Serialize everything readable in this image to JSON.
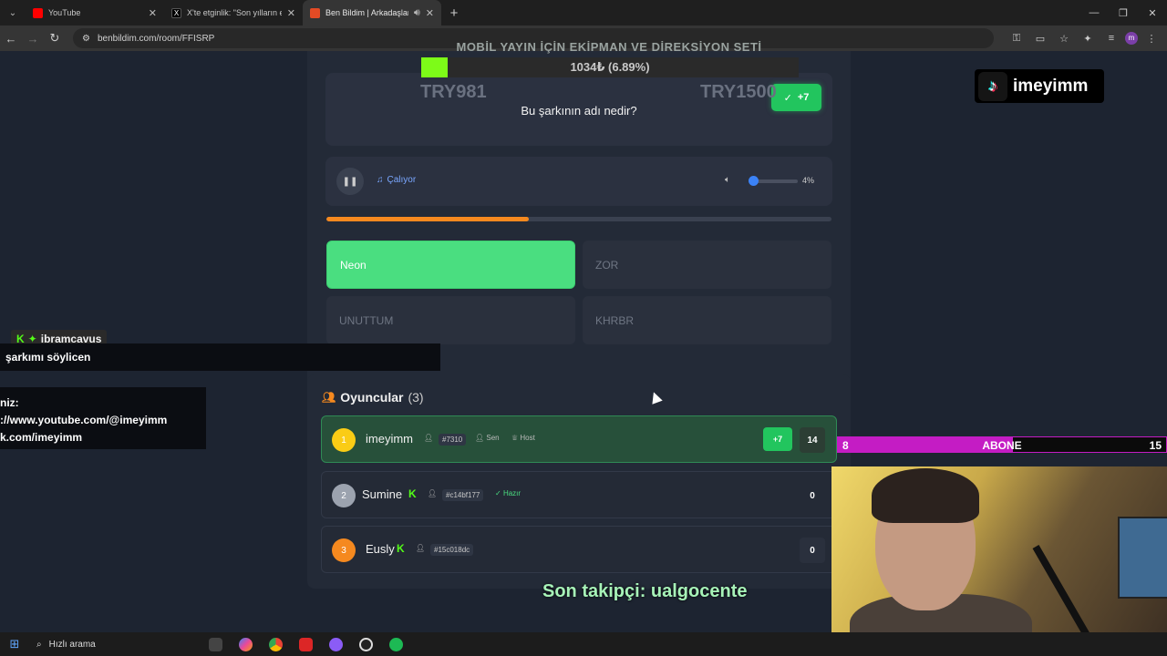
{
  "browser": {
    "tabs": [
      {
        "title": "YouTube",
        "active": false
      },
      {
        "title": "X'te etginlik: \"Son yılların en he",
        "active": false
      },
      {
        "title": "Ben Bildim | Arkadaşlarınla",
        "active": true
      }
    ],
    "url": "benbildim.com/room/FFISRP"
  },
  "donation_goal": {
    "title": "MOBİL YAYIN İÇİN EKİPMAN VE DİREKSİYON SETİ",
    "amount_text": "1034₺ (6.89%)",
    "progress_percent": 6.89,
    "left_label": "TRY981",
    "right_label": "TRY1500"
  },
  "question": {
    "text": "Bu şarkının adı nedir?",
    "badge": "+7"
  },
  "audio": {
    "status": "Çalıyor",
    "volume_text": "4%",
    "volume_percent": 4,
    "time_progress_percent": 40
  },
  "answers": [
    {
      "label": "Neon",
      "selected": true
    },
    {
      "label": "ZOR",
      "selected": false
    },
    {
      "label": "UNUTTUM",
      "selected": false
    },
    {
      "label": "KHRBR",
      "selected": false
    }
  ],
  "players_panel": {
    "title": "Oyuncular",
    "count": "(3)",
    "players": [
      {
        "rank": "1",
        "name": "imeyimm",
        "tag": "#7310",
        "you": "Sen",
        "role": "Host",
        "score": "14",
        "gain": "+7"
      },
      {
        "rank": "2",
        "name": "Sumine",
        "tag": "#c14bf177",
        "status": "Hazır",
        "score": "0"
      },
      {
        "rank": "3",
        "name": "Eusly",
        "tag": "#15c018dc",
        "score": "0"
      }
    ]
  },
  "overlay": {
    "tiktok_name": "imeyimm",
    "chat_user": "ibramcavus",
    "chat_message": "şarkımı söylicen",
    "social_lines": [
      "niz:",
      "://www.youtube.com/@imeyimm",
      "k.com/imeyimm"
    ],
    "sub_goal": {
      "current": "8",
      "label": "ABONE",
      "target": "15",
      "progress_fraction": 0.533
    },
    "last_follower": "Son takipçi: ualgocente"
  },
  "taskbar": {
    "search_text": "Hızlı arama"
  },
  "colors": {
    "accent_green": "#4ade80",
    "progress_orange": "#f5891f",
    "goal_green": "#7dfb18",
    "sub_purple": "#c41cc4"
  }
}
